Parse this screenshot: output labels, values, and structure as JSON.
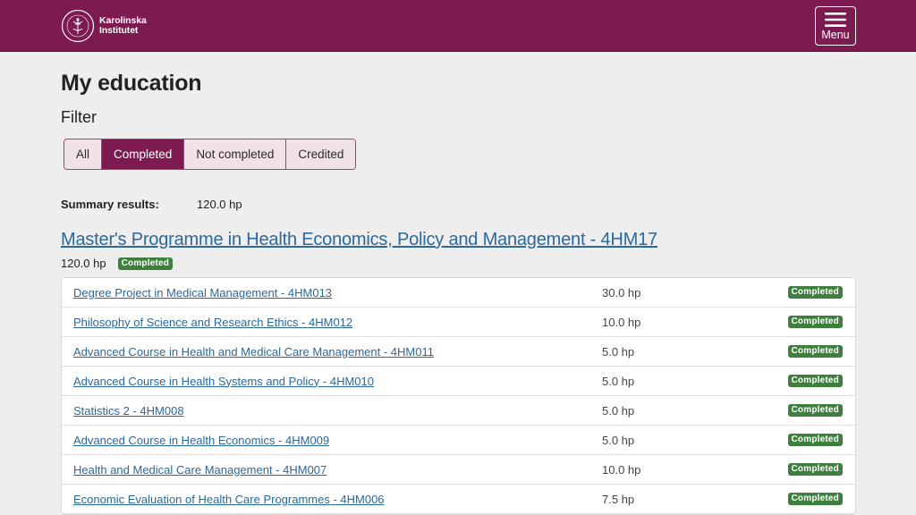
{
  "header": {
    "logo_line1": "Karolinska",
    "logo_line2": "Institutet",
    "menu_label": "Menu"
  },
  "page": {
    "title": "My education",
    "filter_label": "Filter"
  },
  "filters": [
    {
      "label": "All",
      "active": false
    },
    {
      "label": "Completed",
      "active": true
    },
    {
      "label": "Not completed",
      "active": false
    },
    {
      "label": "Credited",
      "active": false
    }
  ],
  "summary": {
    "label": "Summary results:",
    "value": "120.0 hp"
  },
  "program": {
    "title": "Master's Programme in Health Economics, Policy and Management - 4HM17",
    "credits": "120.0 hp",
    "status": "Completed"
  },
  "courses": [
    {
      "name": "Degree Project in Medical Management - 4HM013",
      "credits": "30.0 hp",
      "status": "Completed"
    },
    {
      "name": "Philosophy of Science and Research Ethics - 4HM012",
      "credits": "10.0 hp",
      "status": "Completed"
    },
    {
      "name": "Advanced Course in Health and Medical Care Management - 4HM011",
      "credits": "5.0 hp",
      "status": "Completed"
    },
    {
      "name": "Advanced Course in Health Systems and Policy - 4HM010",
      "credits": "5.0 hp",
      "status": "Completed"
    },
    {
      "name": "Statistics 2 - 4HM008",
      "credits": "5.0 hp",
      "status": "Completed"
    },
    {
      "name": "Advanced Course in Health Economics - 4HM009",
      "credits": "5.0 hp",
      "status": "Completed"
    },
    {
      "name": "Health and Medical Care Management - 4HM007",
      "credits": "10.0 hp",
      "status": "Completed"
    },
    {
      "name": "Economic Evaluation of Health Care Programmes - 4HM006",
      "credits": "7.5 hp",
      "status": "Completed"
    }
  ],
  "colors": {
    "brand": "#7d1a50",
    "link": "#2b689c",
    "badge": "#3e7f3e"
  }
}
